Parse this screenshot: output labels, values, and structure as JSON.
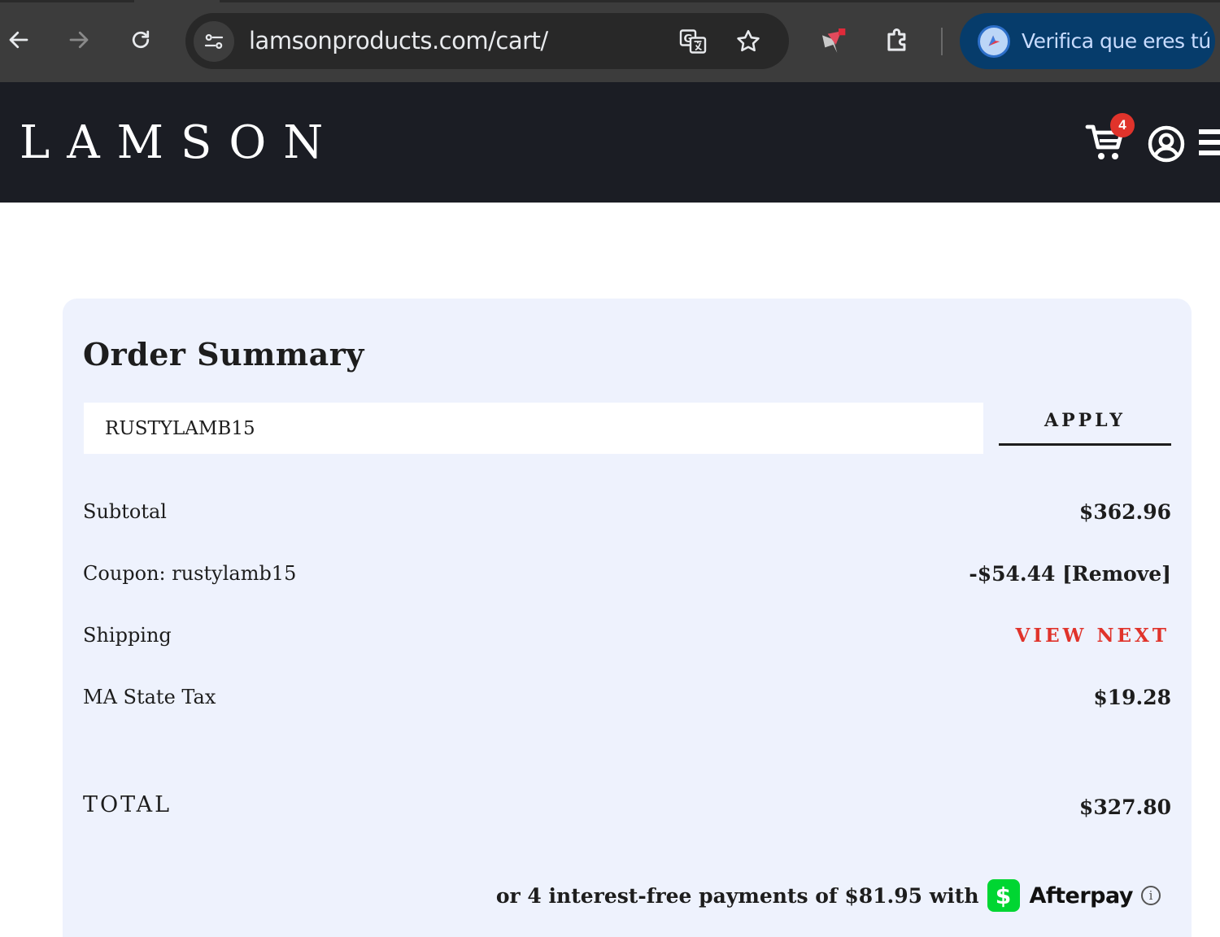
{
  "browser": {
    "url": "lamsonproducts.com/cart/",
    "profile_prompt": "Verifica que eres tú",
    "icons": [
      "back-icon",
      "forward-icon",
      "reload-icon",
      "site-info-icon",
      "translate-icon",
      "bookmark-star-icon",
      "extension-pin-icon",
      "extensions-puzzle-icon",
      "verify-account-icon"
    ]
  },
  "site": {
    "logo": "LAMSON",
    "cart_count": "4",
    "icons": [
      "cart-icon",
      "account-icon",
      "menu-icon"
    ]
  },
  "order_summary": {
    "title": "Order Summary",
    "coupon_input_value": "RUSTYLAMB15",
    "apply_label": "APPLY",
    "rows": {
      "subtotal": {
        "label": "Subtotal",
        "value": "$362.96"
      },
      "coupon": {
        "label": "Coupon: rustylamb15",
        "value": "-$54.44 [Remove]"
      },
      "shipping": {
        "label": "Shipping",
        "value": "VIEW NEXT"
      },
      "tax": {
        "label": "MA State Tax",
        "value": "$19.28"
      }
    },
    "total": {
      "label": "TOTAL",
      "value": "$327.80"
    },
    "afterpay": {
      "text": "or 4 interest-free payments of $81.95 with",
      "cashapp_glyph": "$",
      "brand": "Afterpay",
      "info_glyph": "i"
    }
  },
  "colors": {
    "chrome_bg": "#3c3c3c",
    "header_bg": "#1b1d24",
    "card_bg": "#eef2fd",
    "accent_red": "#e0332b",
    "afterpay_green": "#00d632"
  }
}
